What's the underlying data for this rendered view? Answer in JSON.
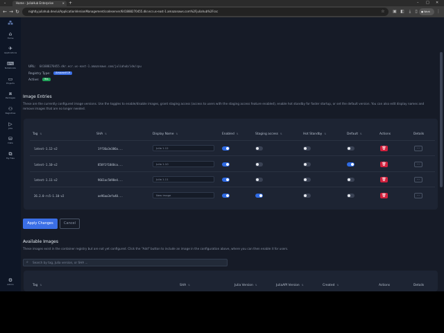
{
  "browser": {
    "tab_title": "Home - JuliaHub Enterprise",
    "tab_close": "×",
    "new_tab": "+",
    "win_min": "–",
    "win_max": "□",
    "win_close": "✕",
    "url": "nightly.juliahub.dev/ui/ApplicationVersionManagement/codeserver/641888270455.dkr.ecr.us-east-1.amazonaws.com%2Fjuliahub%2Fcsc",
    "profile": "Work"
  },
  "sidebar": {
    "items": [
      {
        "label": "Home",
        "icon": "⌂"
      },
      {
        "label": "Applications",
        "icon": "✈"
      },
      {
        "label": "Notebooks",
        "icon": "⌨"
      },
      {
        "label": "Projects",
        "icon": "▭"
      },
      {
        "label": "Packages",
        "icon": "⧈"
      },
      {
        "label": "Registries",
        "icon": "⚇"
      },
      {
        "label": "Jobs",
        "icon": "▷"
      },
      {
        "label": "Data",
        "icon": "⛁"
      },
      {
        "label": "My Files",
        "icon": "⧉"
      }
    ],
    "admin": {
      "label": "Admin",
      "icon": "⚙"
    }
  },
  "registry": {
    "url_label": "URL:",
    "url_value": "641888270455.dkr.ecr.us-east-1.amazonaws.com/juliahub/ide/cpu",
    "type_label": "Registry Type:",
    "type_value": "AmazonECR",
    "active_label": "Active:",
    "active_value": "Yes"
  },
  "image_entries": {
    "title": "Image Entries",
    "description_line1": "These are the currently configured image versions. Use the toggles to enable/disable images, grant staging access (access to users with the staging access feature enabled), enable hot standby for faster startup, or set the default version. You can also edit display names and",
    "description_line2": "remove images that are no longer needed.",
    "headers": [
      "Tag",
      "SHA",
      "Display Name",
      "Enabled",
      "Staging access",
      "Hot Standby",
      "Default",
      "Actions",
      "Details"
    ],
    "rows": [
      {
        "tag": "latest-1.12-v2",
        "sha": "1ff36a3e386a...",
        "display": "Julia 1.12",
        "enabled": true,
        "staging": false,
        "hot": false,
        "default": false
      },
      {
        "tag": "latest-1.10-v2",
        "sha": "858f1f1848ca...",
        "display": "Julia 1.10",
        "enabled": true,
        "staging": false,
        "hot": false,
        "default": true
      },
      {
        "tag": "latest-1.11-v2",
        "sha": "9661ac5b98e4...",
        "display": "Julia 1.11",
        "enabled": true,
        "staging": false,
        "hot": false,
        "default": false
      },
      {
        "tag": "26.2.0-rc5-1.10-v2",
        "sha": "ae96aa3efa40...",
        "display": "New image",
        "enabled": true,
        "staging": true,
        "hot": false,
        "default": false
      }
    ],
    "delete_icon": "🗑",
    "details_icon": "···",
    "apply_label": "Apply Changes",
    "cancel_label": "Cancel"
  },
  "available": {
    "title": "Available Images",
    "description": "These images exist in the container registry but are not yet configured. Click the \"Add\" button to include an image in the configuration above, where you can then enable it for users.",
    "search_placeholder": "Search by tag, Julia version, or SHA ...",
    "headers": [
      "Tag",
      "SHA",
      "Julia Version",
      "JuliaAPI Version",
      "Created",
      "Actions",
      "Details"
    ]
  },
  "colors": {
    "accent": "#3b6fe6",
    "danger": "#d1203d",
    "background": "#161b27",
    "panel": "#1d2433"
  }
}
